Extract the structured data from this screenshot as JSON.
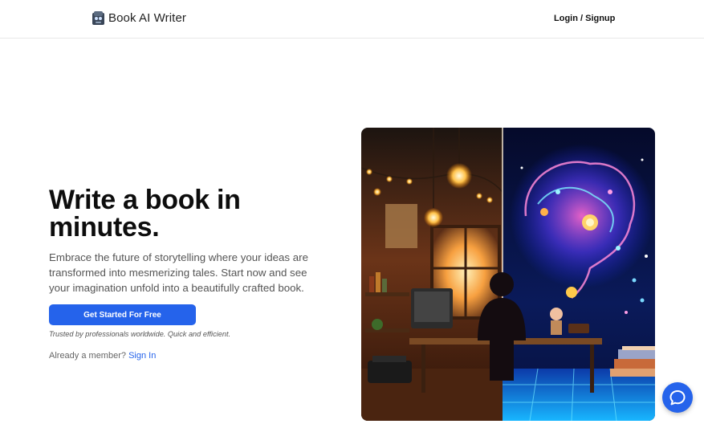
{
  "header": {
    "brand_name": "Book AI Writer",
    "logo_icon": "book-robot-logo-icon",
    "login_label": "Login / Signup"
  },
  "hero": {
    "title_line1": "Write a book in",
    "title_line2": "minutes.",
    "description": "Embrace the future of storytelling where your ideas are transformed into mesmerizing tales. Start now and see your imagination unfold into a beautifully crafted book.",
    "cta_label": "Get Started For Free",
    "trust_text": "Trusted by professionals worldwide. Quick and efficient.",
    "member_prompt": "Already a member?",
    "signin_label": "Sign In",
    "image": "writer-at-desk-warm-room-and-glowing-brain-illustration"
  },
  "chat_widget": {
    "icon": "chat-bubble-icon"
  },
  "colors": {
    "accent": "#2563eb",
    "heading": "#0d0d0d",
    "body_text": "#555555",
    "divider": "#e8e8e8"
  }
}
